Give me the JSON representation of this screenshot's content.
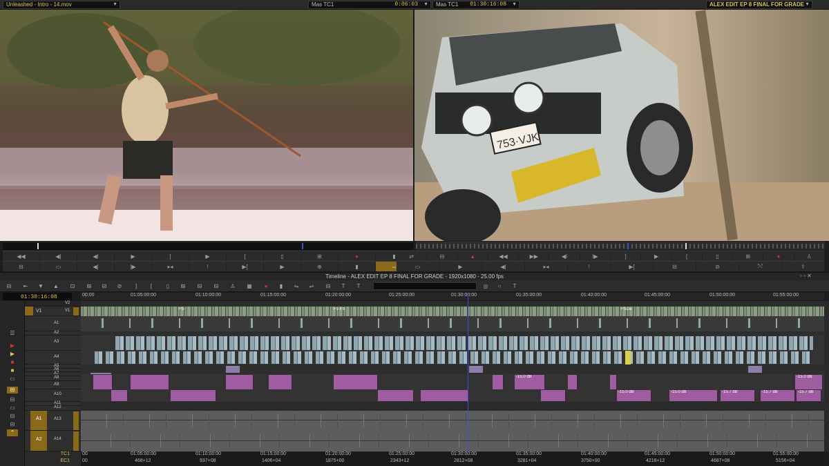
{
  "topbar": {
    "left_clip": "Unleashed - Intro - 14.mov",
    "center_mas_label": "Mas  TC1",
    "center_mas_value": "0:06:03",
    "center_tc_label": "Mas  TC1",
    "center_tc_value": "01:30:16:08",
    "right_sequence": "ALEX EDIT EP 8 FINAL FOR GRADE"
  },
  "timeline": {
    "title": "Timeline - ALEX EDIT EP 8 FINAL FOR GRADE - 1920x1080 - 25.00 fps",
    "timecode": "01:30:16:08",
    "ruler_ticks": [
      "00:00",
      "01:05:00:00",
      "01:10:00:00",
      "01:15:00:00",
      "01:20:00:00",
      "01:25:00:00",
      "01:30:00:00",
      "01:35:00:00",
      "01:40:00:00",
      "01:45:00:00",
      "01:50:00:00",
      "01:55:00:00"
    ],
    "tracks": {
      "v2": "V2",
      "v1": "V1",
      "a1": "A1",
      "a2": "A2",
      "a3": "A3",
      "a4": "A4",
      "a5": "A5",
      "a6": "A6",
      "a7": "A7",
      "a8": "A8",
      "a9": "A9",
      "a10": "A10",
      "a11": "A11",
      "a12": "A12",
      "a13": "A13",
      "a14": "A14",
      "sel_v1": "V1",
      "sel_a1": "A1",
      "sel_a2": "A2"
    },
    "clip_labels": {
      "db1": "-15.0 dB",
      "db2": "-15.0 dB",
      "db3": "-15.0 dB",
      "db4": "-15.0 dB",
      "db5": "-15.0 dB",
      "db6": "-15.7 dB",
      "db7": "-15.7 dB",
      "db8": "-15.7 dB",
      "fs1": "FS",
      "fs2": "F5 FS",
      "fs3": "FSDa"
    },
    "bottom_tc_label": "TC1",
    "bottom_ec_label": "EC1",
    "bottom_tc": [
      "00",
      "01:05:00:00",
      "01:10:00:00",
      "01:15:00:00",
      "01:20:00:00",
      "01:25:00:00",
      "01:30:00:00",
      "01:35:00:00",
      "01:40:00:00",
      "01:45:00:00",
      "01:50:00:00",
      "01:55:00:00"
    ],
    "bottom_ec": [
      "00",
      "468+12",
      "937+08",
      "1406+04",
      "1875+00",
      "2343+12",
      "2812+08",
      "3281+04",
      "3750+00",
      "4218+12",
      "4687+08",
      "5156+04"
    ]
  },
  "colors": {
    "accent": "#8a6a18",
    "timecode": "#d8c25a",
    "playhead": "#3a4fd8",
    "video_clip": "#7f8f79",
    "audio_clip": "#8fa6b2",
    "music_clip": "#a05ca0"
  }
}
